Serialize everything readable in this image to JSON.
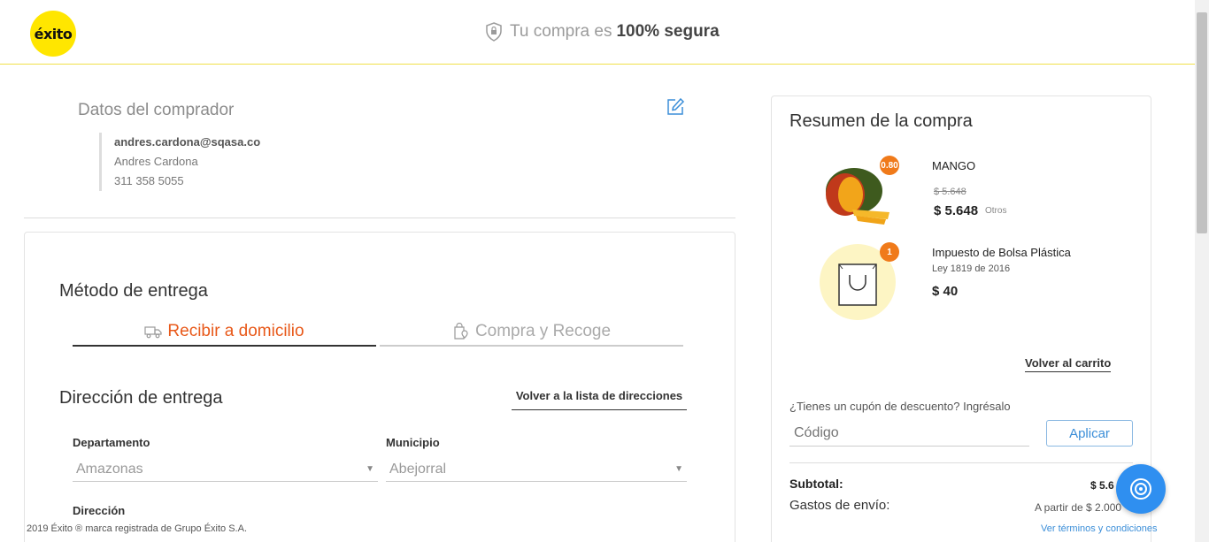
{
  "header": {
    "logo_text": "éxito",
    "secure_prefix": "Tu compra es",
    "secure_strong": "100% segura"
  },
  "buyer": {
    "title": "Datos del comprador",
    "email": "andres.cardona@sqasa.co",
    "name": "Andres Cardona",
    "phone": "311 358 5055"
  },
  "delivery": {
    "method_title": "Método de entrega",
    "tabs": [
      {
        "label": "Recibir a domicilio",
        "active": true
      },
      {
        "label": "Compra y Recoge",
        "active": false
      }
    ],
    "address_title": "Dirección de entrega",
    "back_to_list": "Volver a la lista de direcciones",
    "department_label": "Departamento",
    "department_value": "Amazonas",
    "municipality_label": "Municipio",
    "municipality_value": "Abejorral",
    "address_label": "Dirección"
  },
  "summary": {
    "title": "Resumen de la compra",
    "items": [
      {
        "name": "MANGO",
        "badge": "0.80",
        "old_price": "$ 5.648",
        "price": "$ 5.648",
        "seller": "Otros"
      },
      {
        "name": "Impuesto de Bolsa Plástica",
        "badge": "1",
        "note": "Ley 1819 de 2016",
        "price": "$ 40"
      }
    ],
    "back_to_cart": "Volver al carrito",
    "coupon_question": "¿Tienes un cupón de descuento? Ingrésalo",
    "coupon_placeholder": "Código",
    "apply_label": "Aplicar",
    "subtotal_label": "Subtotal:",
    "subtotal_value": "$ 5.6",
    "shipping_label": "Gastos de envío:",
    "shipping_value": "A partir de $ 2.000"
  },
  "footer": {
    "copyright": "2019 Éxito ® marca registrada de Grupo Éxito S.A.",
    "terms": "Ver términos y condiciones"
  },
  "colors": {
    "brand_yellow": "#ffe600",
    "accent_orange": "#e8591a",
    "link_blue": "#3b8ed8"
  }
}
